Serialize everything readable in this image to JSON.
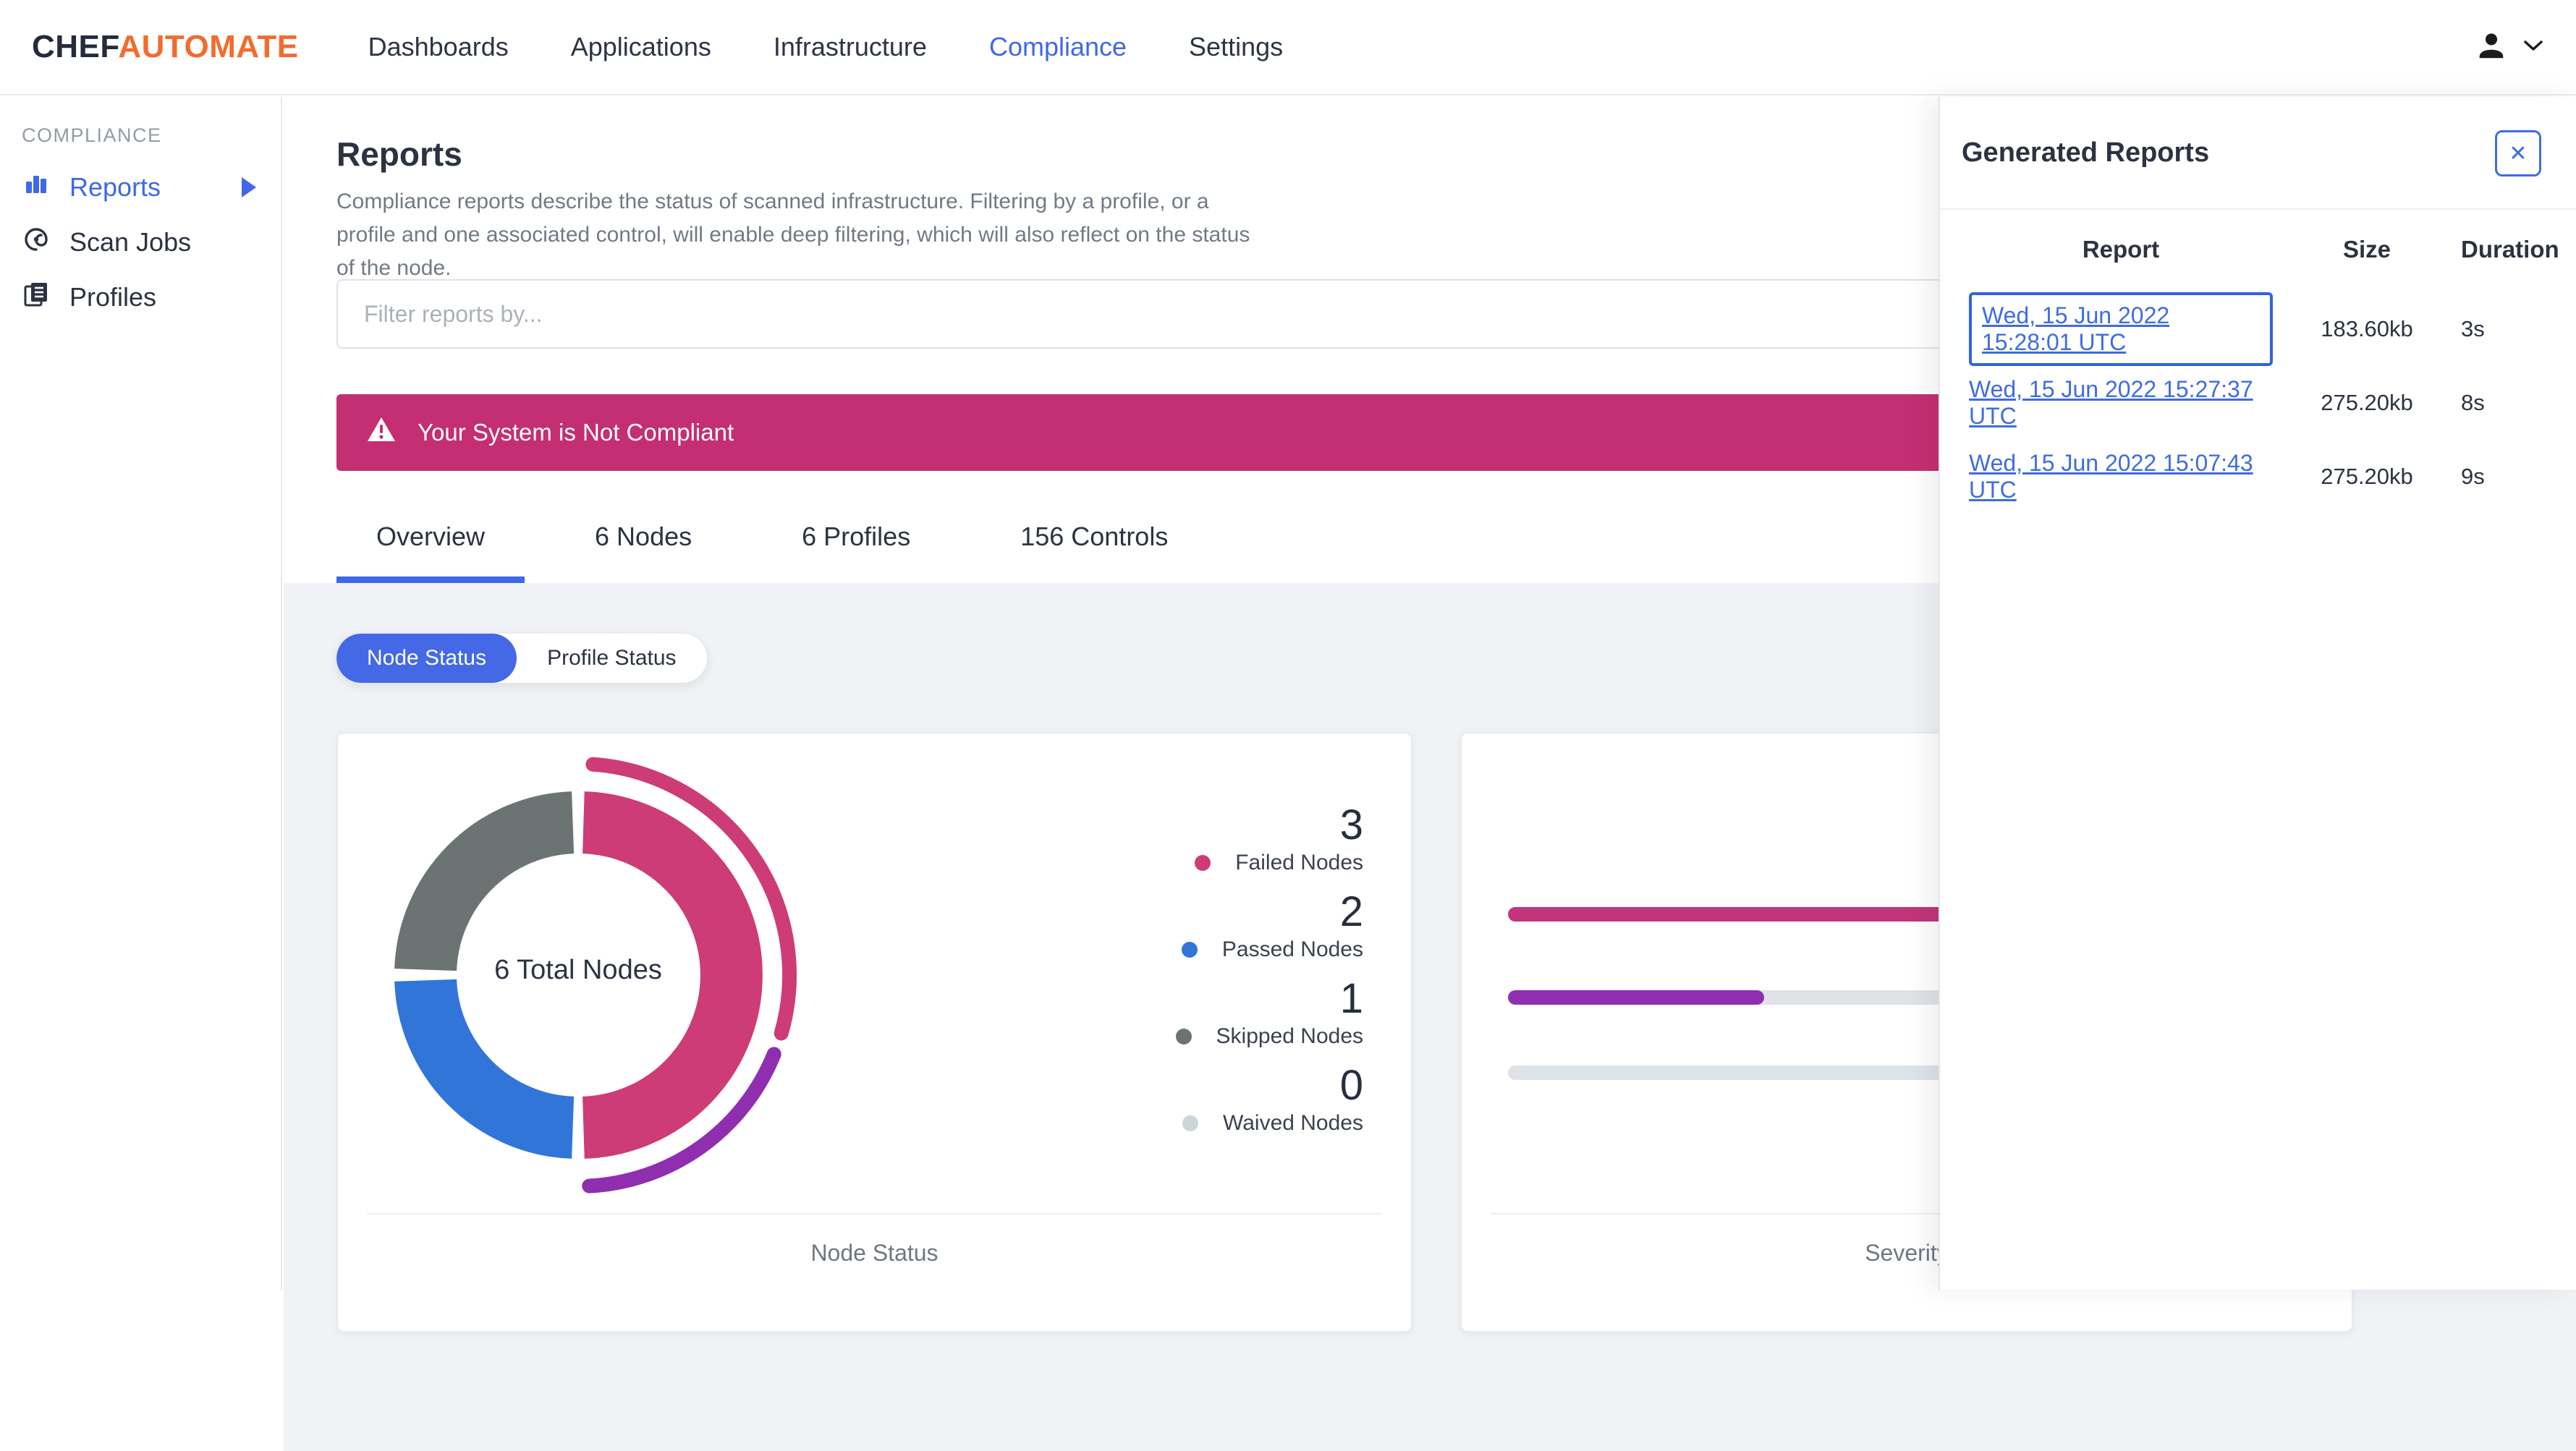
{
  "nav": {
    "brand": {
      "chef": "CHEF",
      "automate": "AUTOMATE"
    },
    "items": [
      {
        "label": "Dashboards"
      },
      {
        "label": "Applications"
      },
      {
        "label": "Infrastructure"
      },
      {
        "label": "Compliance",
        "active": true
      },
      {
        "label": "Settings"
      }
    ]
  },
  "sidebar": {
    "section": "COMPLIANCE",
    "items": [
      {
        "label": "Reports",
        "icon": "bar-chart-icon",
        "active": true
      },
      {
        "label": "Scan Jobs",
        "icon": "broadcast-icon"
      },
      {
        "label": "Profiles",
        "icon": "profiles-icon"
      }
    ]
  },
  "page": {
    "title": "Reports",
    "description": "Compliance reports describe the status of scanned infrastructure. Filtering by a profile, or a profile and one associated control, will enable deep filtering, which will also reflect on the status of the node.",
    "filter_placeholder": "Filter reports by...",
    "alert_text": "Your System is Not Compliant"
  },
  "tabs": [
    {
      "label": "Overview",
      "active": true
    },
    {
      "label": "6 Nodes"
    },
    {
      "label": "6 Profiles"
    },
    {
      "label": "156 Controls"
    }
  ],
  "toggles": [
    {
      "label": "Node Status",
      "active": true
    },
    {
      "label": "Profile Status"
    }
  ],
  "chart_data": [
    {
      "type": "pie",
      "subtype": "donut",
      "title": "Node Status",
      "center_label": "6 Total Nodes",
      "categories": [
        "Failed Nodes",
        "Passed Nodes",
        "Skipped Nodes",
        "Waived Nodes"
      ],
      "values": [
        3,
        2,
        1,
        0
      ],
      "colors": [
        "#cd3c77",
        "#3175d9",
        "#6c7373",
        "#ccd5da"
      ],
      "outer_arc_colors": [
        "#cd3c77",
        "#8f2fb0"
      ],
      "legend_position": "right"
    },
    {
      "type": "bar",
      "orientation": "horizontal",
      "title": "Severity",
      "values_pct": [
        100,
        32,
        0
      ],
      "colors": [
        "#c2347b",
        "#8f2fb0",
        "#dfe3e7"
      ],
      "track_color": "#dfe3e7"
    }
  ],
  "panel": {
    "title": "Generated Reports",
    "close_label": "✕",
    "columns": [
      "Report",
      "Size",
      "Duration"
    ],
    "rows": [
      {
        "report": "Wed, 15 Jun 2022 15:28:01 UTC",
        "size": "183.60kb",
        "duration": "3s",
        "selected": true
      },
      {
        "report": "Wed, 15 Jun 2022 15:27:37 UTC",
        "size": "275.20kb",
        "duration": "8s"
      },
      {
        "report": "Wed, 15 Jun 2022 15:07:43 UTC",
        "size": "275.20kb",
        "duration": "9s"
      }
    ]
  },
  "colors": {
    "accent_blue": "#3f68e8",
    "pill_blue": "#4468e6",
    "alert_pink": "#c42e72",
    "link_blue": "#3f6ce0",
    "brand_orange": "#f26c2e",
    "text_navy": "#2b3342",
    "bg_gray": "#f0f2f5"
  }
}
